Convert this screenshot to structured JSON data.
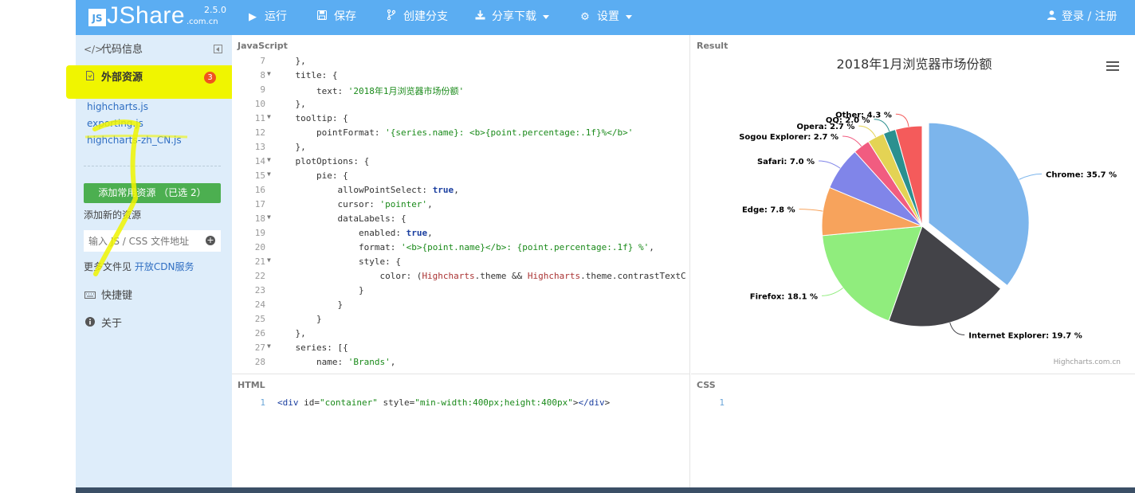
{
  "logo": {
    "badge": "JS",
    "name": "JShare",
    "domain": ".com.cn",
    "version": "2.5.0"
  },
  "toolbar": {
    "run": "运行",
    "save": "保存",
    "branch": "创建分支",
    "share": "分享下载",
    "settings": "设置",
    "login": "登录 / 注册"
  },
  "sidebar": {
    "code_info": "代码信息",
    "external_resources": "外部资源",
    "resource_count": "3",
    "libs": [
      "highcharts.js",
      "exporting.js",
      "highcharts-zh_CN.js"
    ],
    "add_common_button": "添加常用资源 （已选 2）",
    "add_new_label": "添加新的资源",
    "url_placeholder": "输入 JS / CSS 文件地址",
    "more_files_prefix": "更多文件见",
    "cdn_link": "开放CDN服务",
    "shortcuts": "快捷键",
    "about": "关于"
  },
  "panels": {
    "js": "JavaScript",
    "result": "Result",
    "html": "HTML",
    "css": "CSS"
  },
  "js_code": [
    {
      "n": "7",
      "t": "    },"
    },
    {
      "n": "8",
      "t": "    title: {"
    },
    {
      "n": "9",
      "t": "        text: '2018年1月浏览器市场份额'"
    },
    {
      "n": "10",
      "t": "    },"
    },
    {
      "n": "11",
      "t": "    tooltip: {"
    },
    {
      "n": "12",
      "t": "        pointFormat: '{series.name}: <b>{point.percentage:.1f}%</b>'"
    },
    {
      "n": "13",
      "t": "    },"
    },
    {
      "n": "14",
      "t": "    plotOptions: {"
    },
    {
      "n": "15",
      "t": "        pie: {"
    },
    {
      "n": "16",
      "t": "            allowPointSelect: true,"
    },
    {
      "n": "17",
      "t": "            cursor: 'pointer',"
    },
    {
      "n": "18",
      "t": "            dataLabels: {"
    },
    {
      "n": "19",
      "t": "                enabled: true,"
    },
    {
      "n": "20",
      "t": "                format: '<b>{point.name}</b>: {point.percentage:.1f} %',"
    },
    {
      "n": "21",
      "t": "                style: {"
    },
    {
      "n": "22",
      "t": "                    color: (Highcharts.theme && Highcharts.theme.contrastTextC"
    },
    {
      "n": "23",
      "t": "                }"
    },
    {
      "n": "24",
      "t": "            }"
    },
    {
      "n": "25",
      "t": "        }"
    },
    {
      "n": "26",
      "t": "    },"
    },
    {
      "n": "27",
      "t": "    series: [{"
    },
    {
      "n": "28",
      "t": "        name: 'Brands',"
    }
  ],
  "html_code": [
    {
      "n": "1",
      "t": "<div id=\"container\" style=\"min-width:400px;height:400px\"></div>"
    }
  ],
  "css_code": [
    {
      "n": "1",
      "t": ""
    }
  ],
  "chart_data": {
    "type": "pie",
    "title": "2018年1月浏览器市场份额",
    "credits": "Highcharts.com.cn",
    "slices": [
      {
        "name": "Chrome",
        "value": 35.7,
        "color": "#7cb5ec",
        "label": "Chrome: 35.7 %",
        "sliced": true
      },
      {
        "name": "Internet Explorer",
        "value": 19.7,
        "color": "#434348",
        "label": "Internet Explorer: 19.7 %"
      },
      {
        "name": "Firefox",
        "value": 18.1,
        "color": "#90ed7d",
        "label": "Firefox: 18.1 %"
      },
      {
        "name": "Edge",
        "value": 7.8,
        "color": "#f7a35c",
        "label": "Edge: 7.8 %"
      },
      {
        "name": "Safari",
        "value": 7.0,
        "color": "#8085e9",
        "label": "Safari: 7.0 %"
      },
      {
        "name": "Sogou Explorer",
        "value": 2.7,
        "color": "#f15c80",
        "label": "Sogou Explorer: 2.7 %"
      },
      {
        "name": "Opera",
        "value": 2.7,
        "color": "#e4d354",
        "label": "Opera: 2.7 %"
      },
      {
        "name": "QQ",
        "value": 2.0,
        "color": "#2b908f",
        "label": "QQ: 2.0 %"
      },
      {
        "name": "Other",
        "value": 4.3,
        "color": "#f45b5b",
        "label": "Other: 4.3 %"
      }
    ]
  }
}
